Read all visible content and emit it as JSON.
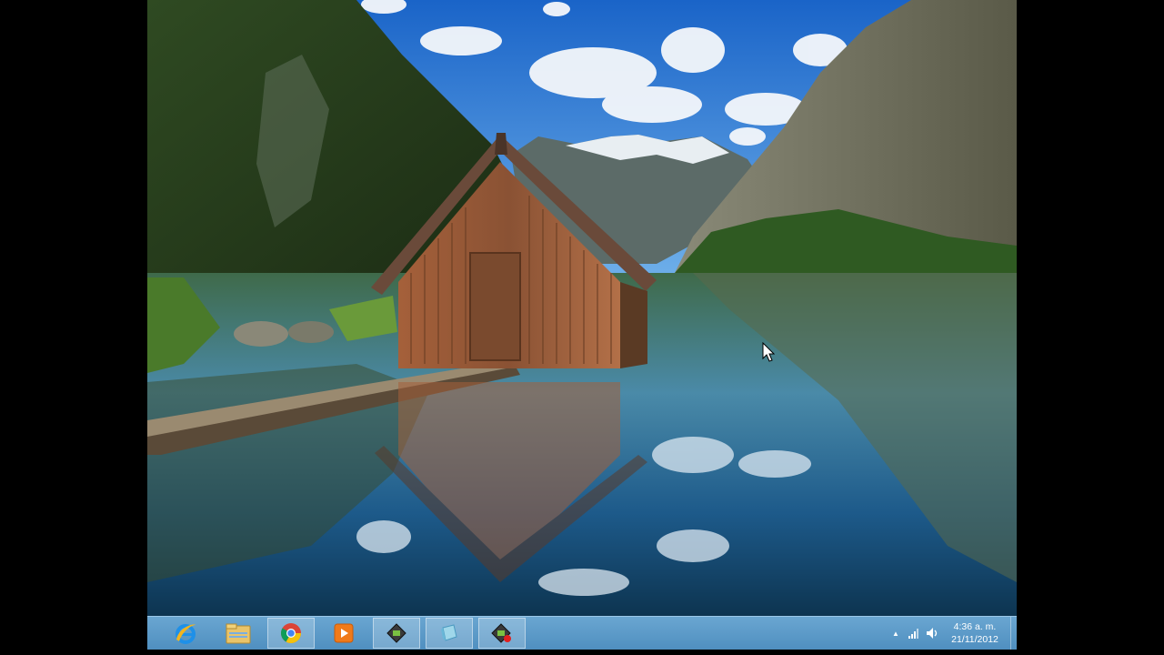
{
  "wallpaper": {
    "scene": "boathouse-lake-mountains"
  },
  "taskbar": {
    "pinned": [
      {
        "name": "internet-explorer-icon",
        "active": false
      },
      {
        "name": "file-explorer-icon",
        "active": false
      },
      {
        "name": "chrome-icon",
        "active": true
      },
      {
        "name": "media-player-icon",
        "active": false
      },
      {
        "name": "app-window-icon",
        "active": true
      },
      {
        "name": "app-cube-icon",
        "active": true
      },
      {
        "name": "app-record-icon",
        "active": true
      }
    ],
    "tray": {
      "show_hidden_label": "▲",
      "clock_time": "4:36 a. m.",
      "clock_date": "21/11/2012"
    }
  },
  "colors": {
    "taskbar": "#5b9ac8",
    "sky": "#2a7bd8"
  }
}
